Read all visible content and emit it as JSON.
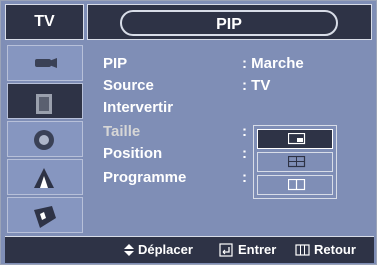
{
  "header": {
    "left": "TV",
    "title": "PIP"
  },
  "menu": [
    {
      "label": "PIP",
      "sep": ": ",
      "value": "Marche"
    },
    {
      "label": "Source",
      "sep": ": ",
      "value": "TV"
    },
    {
      "label": "Intervertir",
      "sep": "",
      "value": ""
    },
    {
      "label": "Taille",
      "sep": ":",
      "value": ""
    },
    {
      "label": "Position",
      "sep": ":",
      "value": ""
    },
    {
      "label": "Programme",
      "sep": ":",
      "value": ""
    }
  ],
  "size_options": [
    "small-pip-icon",
    "double-screen-icon",
    "split-screen-icon"
  ],
  "footer": {
    "move": "Déplacer",
    "enter": "Entrer",
    "back": "Retour"
  },
  "colors": {
    "panel": "#7f8eb6",
    "dark": "#2e3346",
    "text": "#ffffff",
    "dim": "#d6d6d6"
  }
}
